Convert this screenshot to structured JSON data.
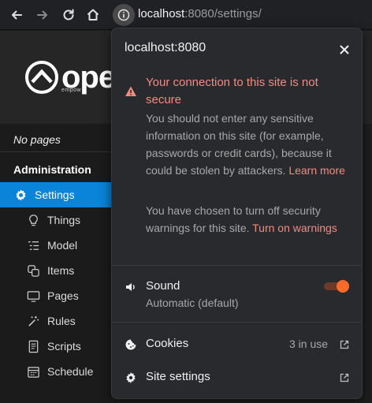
{
  "browser": {
    "url_host": "localhost",
    "url_rest": ":8080/settings/"
  },
  "app": {
    "logo_text": "ope",
    "logo_sub": "empow",
    "no_pages": "No pages",
    "admin_title": "Administration",
    "menu": [
      {
        "label": "Settings",
        "icon": "gear-icon",
        "active": true
      },
      {
        "label": "Things",
        "icon": "lightbulb-icon"
      },
      {
        "label": "Model",
        "icon": "list-tree-icon"
      },
      {
        "label": "Items",
        "icon": "items-icon"
      },
      {
        "label": "Pages",
        "icon": "monitor-icon"
      },
      {
        "label": "Rules",
        "icon": "magic-wand-icon"
      },
      {
        "label": "Scripts",
        "icon": "document-icon"
      },
      {
        "label": "Schedule",
        "icon": "calendar-icon"
      }
    ]
  },
  "popup": {
    "host": "localhost:8080",
    "warning_title": "Your connection to this site is not secure",
    "warning_body": "You should not enter any sensitive information on this site (for example, passwords or credit cards), because it could be stolen by attackers.",
    "learn_more": "Learn more",
    "turnoff_text": "You have chosen to turn off security warnings for this site.",
    "turnon_link": "Turn on warnings",
    "sound_label": "Sound",
    "sound_sub": "Automatic (default)",
    "sound_on": true,
    "cookies_label": "Cookies",
    "cookies_meta": "3 in use",
    "site_settings_label": "Site settings"
  },
  "colors": {
    "accent_blue": "#0a84d8",
    "warning": "#f28b82",
    "toggle_on": "#ff6a2b"
  }
}
